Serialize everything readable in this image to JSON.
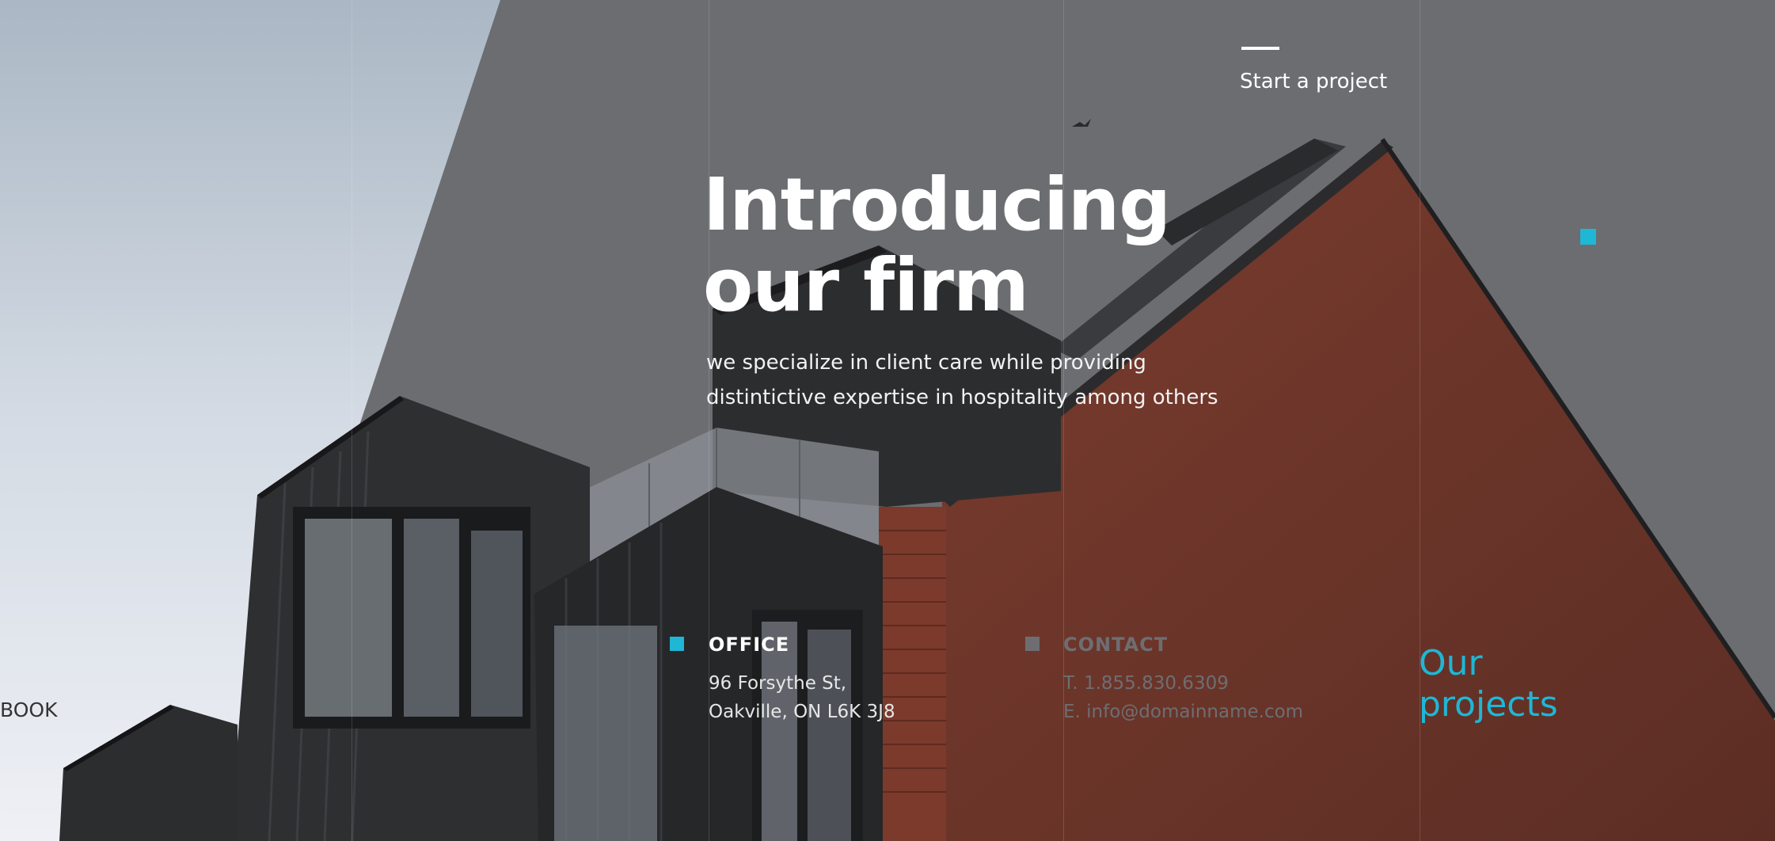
{
  "header": {
    "start_project": "Start a project"
  },
  "hero": {
    "title_line1": "Introducing",
    "title_line2": "our firm",
    "subtitle_line1": "we specialize in client care while providing",
    "subtitle_line2": "distintictive expertise in hospitality among others"
  },
  "office": {
    "title": "OFFICE",
    "address_line1": "96 Forsythe St,",
    "address_line2": "Oakville, ON L6K 3J8"
  },
  "contact": {
    "title": "CONTACT",
    "phone": "T. 1.855.830.6309",
    "email": "E. info@domainname.com"
  },
  "projects": {
    "line1": "Our",
    "line2": "projects"
  },
  "side": {
    "book": "BOOK"
  },
  "colors": {
    "accent": "#1eb7d6",
    "gray_square": "#6e6e72",
    "text_white": "#ffffff",
    "overlay": "#6b6d70",
    "brick": "#6a3429",
    "sky": "#d9e0e8"
  },
  "icons": [
    "cyan-square-icon",
    "office-square-icon",
    "contact-square-icon",
    "bird-icon"
  ]
}
